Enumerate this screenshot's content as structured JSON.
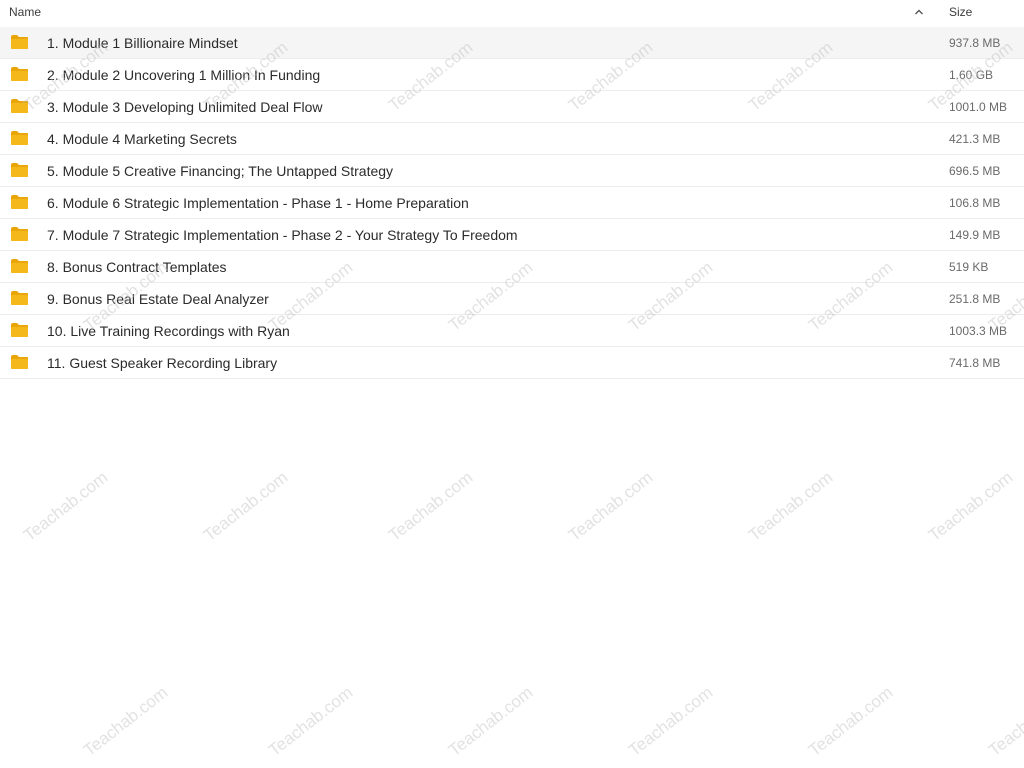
{
  "header": {
    "name_label": "Name",
    "size_label": "Size",
    "sort_direction": "ascending",
    "sort_icon": "chevron-up-icon"
  },
  "colors": {
    "folder": "#f5b81b",
    "folder_dark": "#e8a50c",
    "selected_row": "#f5f5f5"
  },
  "rows": [
    {
      "name": "1. Module 1 Billionaire Mindset",
      "size": "937.8 MB",
      "icon": "folder-icon"
    },
    {
      "name": "2. Module 2 Uncovering 1 Million In Funding",
      "size": "1.60 GB",
      "icon": "folder-icon"
    },
    {
      "name": "3. Module 3 Developing Unlimited Deal Flow",
      "size": "1001.0 MB",
      "icon": "folder-icon"
    },
    {
      "name": "4. Module 4 Marketing Secrets",
      "size": "421.3 MB",
      "icon": "folder-icon"
    },
    {
      "name": "5. Module 5 Creative Financing; The Untapped Strategy",
      "size": "696.5 MB",
      "icon": "folder-icon"
    },
    {
      "name": "6. Module 6 Strategic Implementation - Phase 1 - Home Preparation",
      "size": "106.8 MB",
      "icon": "folder-icon"
    },
    {
      "name": "7. Module 7 Strategic Implementation - Phase 2 - Your Strategy To Freedom",
      "size": "149.9 MB",
      "icon": "folder-icon"
    },
    {
      "name": "8. Bonus Contract Templates",
      "size": "519 KB",
      "icon": "folder-icon"
    },
    {
      "name": "9. Bonus Real Estate Deal Analyzer",
      "size": "251.8 MB",
      "icon": "folder-icon"
    },
    {
      "name": "10. Live Training Recordings with Ryan",
      "size": "1003.3 MB",
      "icon": "folder-icon"
    },
    {
      "name": "11. Guest Speaker Recording Library",
      "size": "741.8 MB",
      "icon": "folder-icon"
    }
  ],
  "watermark": "Teachab.com"
}
